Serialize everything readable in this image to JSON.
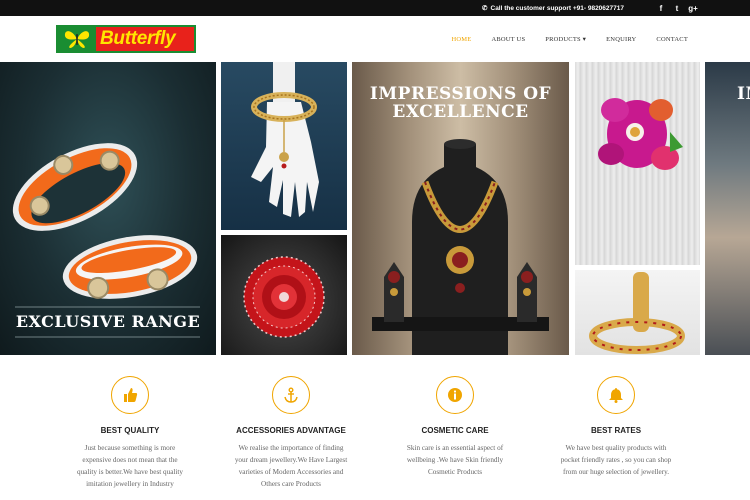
{
  "topbar": {
    "support_text": "Call the customer support +91- 9820627717",
    "social": [
      {
        "label": "f",
        "icon": "facebook-icon"
      },
      {
        "label": "t",
        "icon": "twitter-icon"
      },
      {
        "label": "g+",
        "icon": "google-plus-icon"
      }
    ]
  },
  "brand": {
    "name": "Butterfly",
    "colors": {
      "red": "#e8221b",
      "green": "#1a8d32",
      "yellow": "#ffe600"
    }
  },
  "nav": {
    "items": [
      {
        "label": "HOME",
        "active": true
      },
      {
        "label": "ABOUT US",
        "active": false
      },
      {
        "label": "PRODUCTS",
        "active": false,
        "dropdown": true
      },
      {
        "label": "ENQUIRY",
        "active": false
      },
      {
        "label": "CONTACT",
        "active": false
      }
    ],
    "dropdown_caret": "▾"
  },
  "gallery": {
    "captions": {
      "exclusive": "EXCLUSIVE RANGE",
      "impressions_line1": "IMPRESSIONS OF",
      "impressions_line2": "EXCELLENCE",
      "partial": "IM"
    }
  },
  "accent_color": "#f0a500",
  "features": [
    {
      "icon": "thumbs-up-icon",
      "title": "BEST QUALITY",
      "lines": [
        "Just because something is more",
        "expensive does not mean that the",
        "quality is better.We have best quality",
        "imitation jewellery in Industry"
      ]
    },
    {
      "icon": "anchor-icon",
      "title": "ACCESSORIES ADVANTAGE",
      "lines": [
        "We realise the importance of finding",
        "your dream jewellery.We Have Largest",
        "varieties of Modern Accessories and",
        "Others care Products"
      ]
    },
    {
      "icon": "info-icon",
      "title": "COSMETIC CARE",
      "lines": [
        "Skin care is an essential aspect of",
        "wellbeing .We have Skin friendly",
        "Cosmetic Products"
      ]
    },
    {
      "icon": "bell-icon",
      "title": "BEST RATES",
      "lines": [
        "We have best quality products with",
        "pocket friendly rates , so you can shop",
        "from our huge selection of jewellery."
      ]
    }
  ]
}
